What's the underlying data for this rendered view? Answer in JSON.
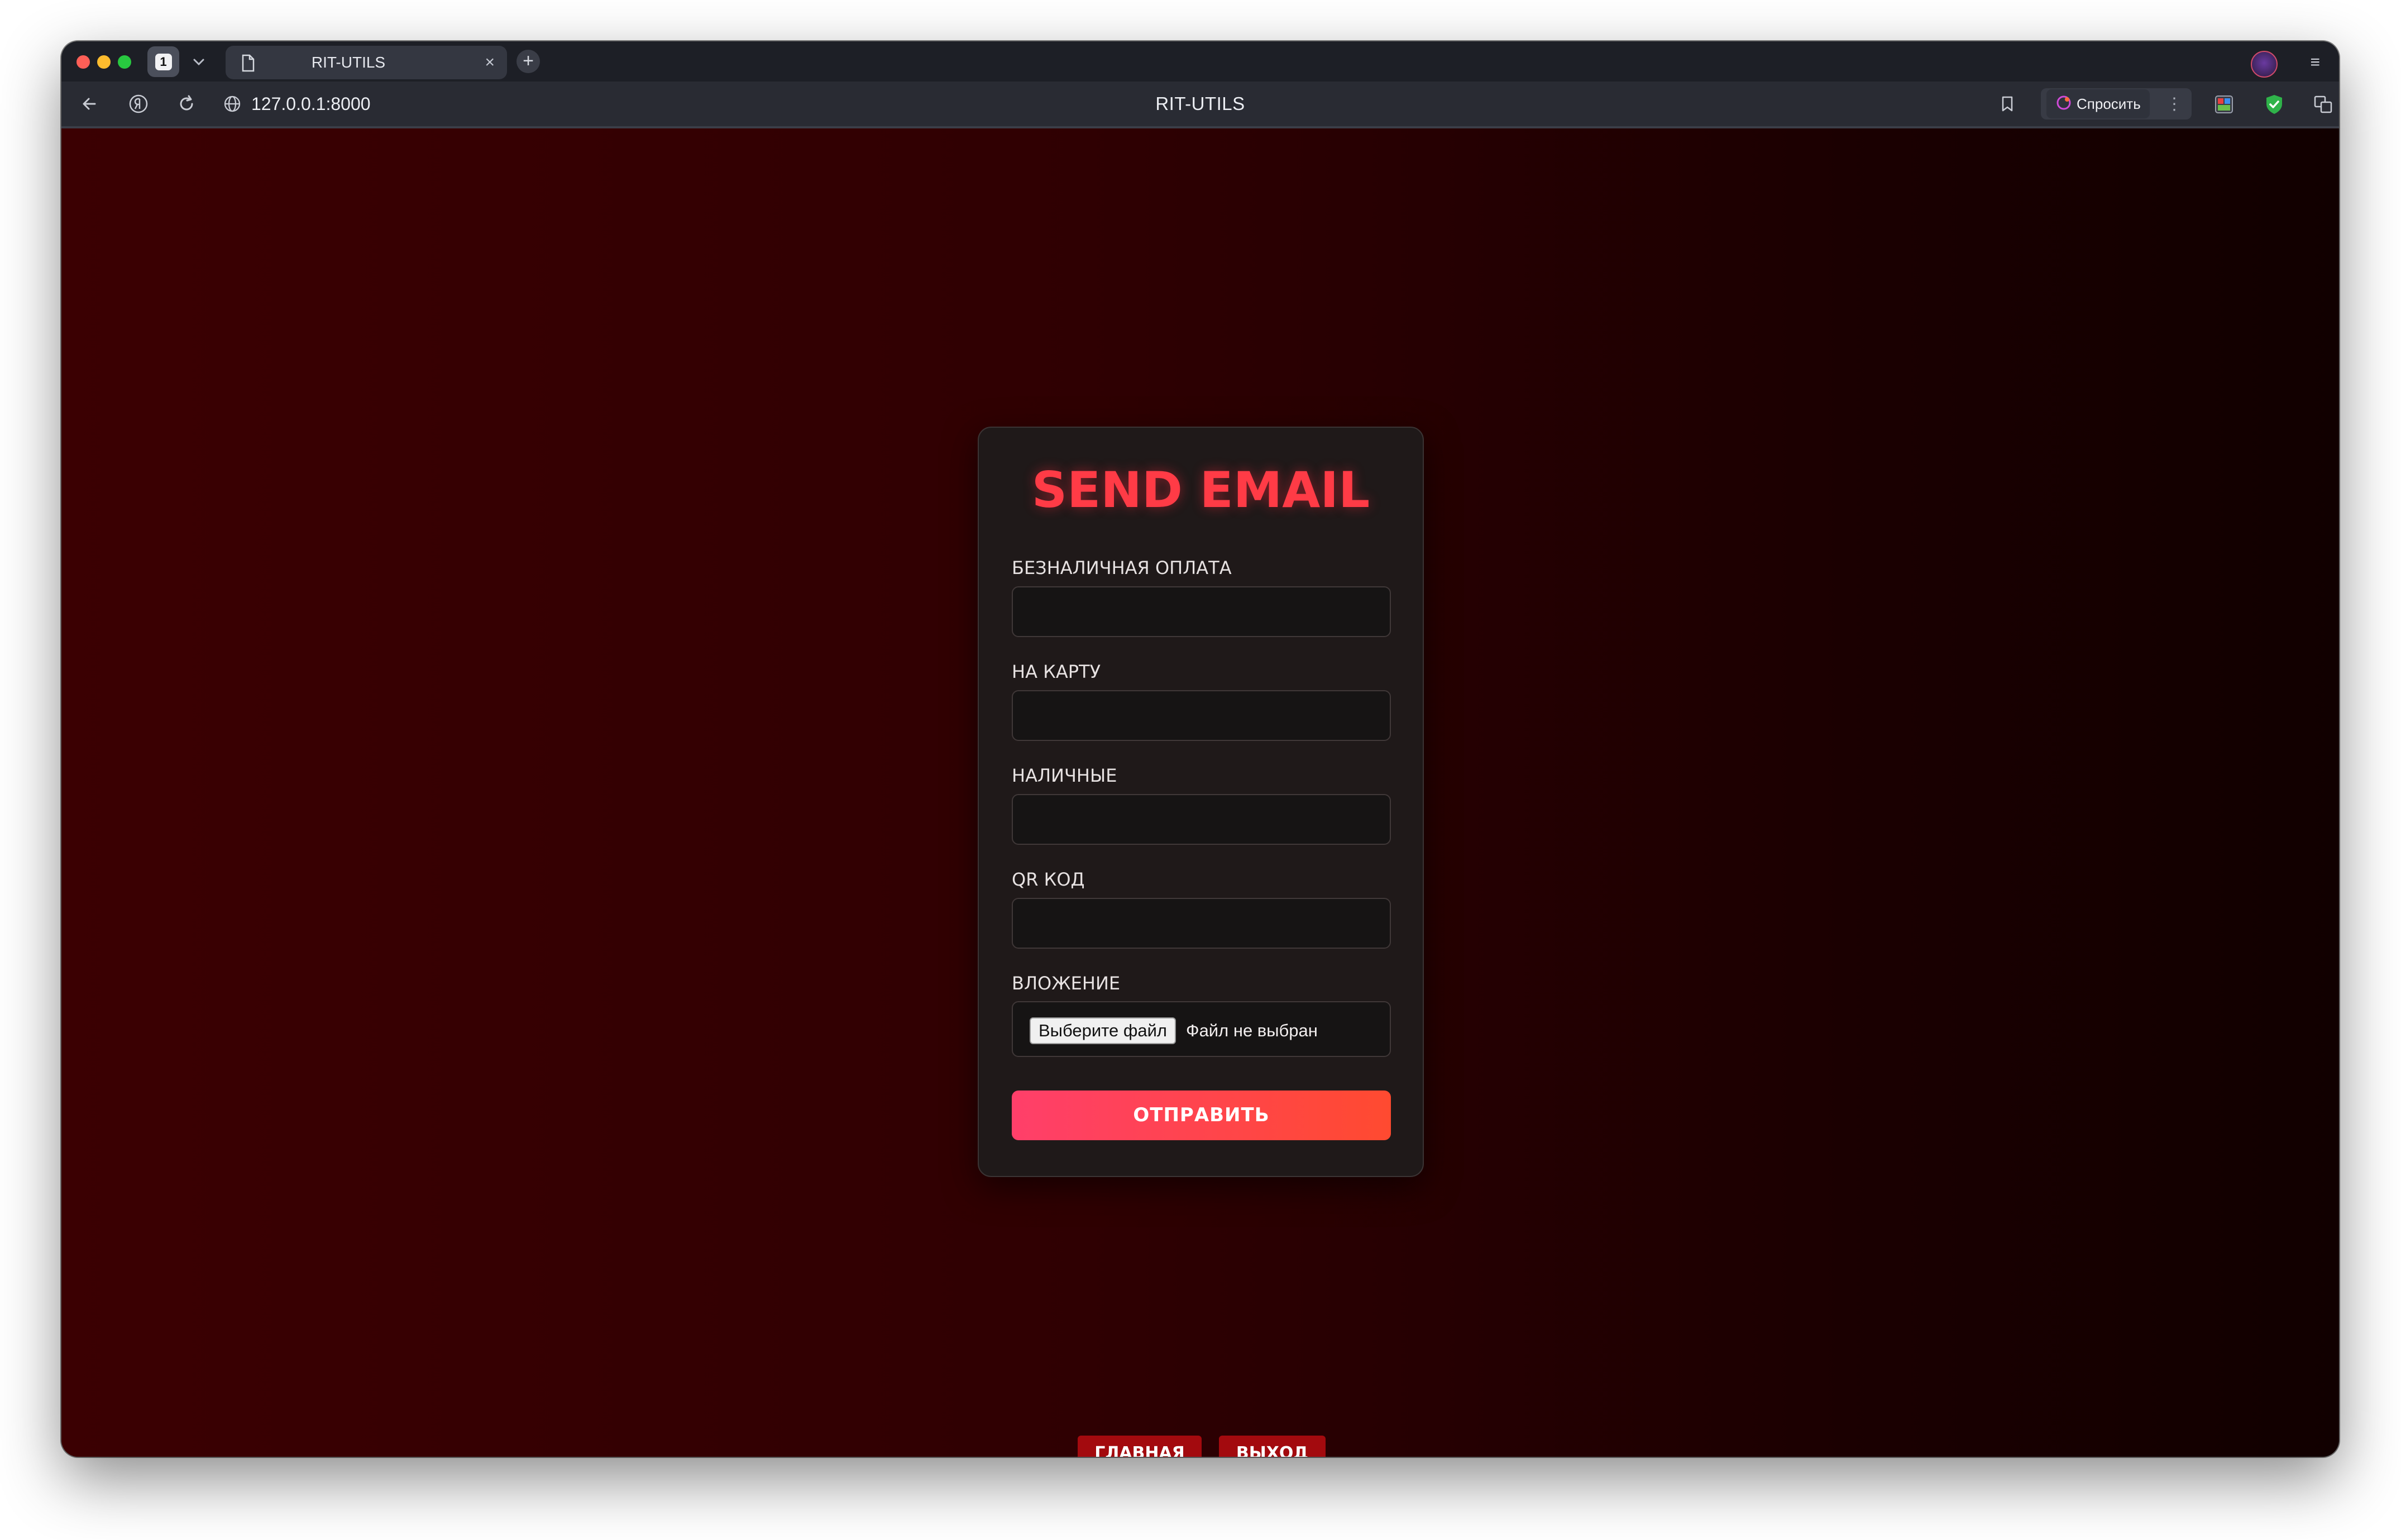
{
  "browser": {
    "tab_count": "1",
    "tab_title": "RIT-UTILS",
    "tab_close": "×",
    "new_tab": "+",
    "url": "127.0.0.1:8000",
    "page_title": "RIT-UTILS",
    "ask_button": "Спросить",
    "menu_glyph": "≡",
    "kebab_glyph": "⋮",
    "icons": [
      "back-icon",
      "yandex-icon",
      "reload-icon",
      "globe-icon",
      "bookmark-icon",
      "extension-icon",
      "shield-icon",
      "translate-icon",
      "download-icon"
    ],
    "colors": {
      "red": "#fe5f57",
      "yellow": "#febc2e",
      "green": "#28c840"
    }
  },
  "form": {
    "title": "SEND EMAIL",
    "fields": [
      {
        "label": "БЕЗНАЛИЧНАЯ ОПЛАТА",
        "value": ""
      },
      {
        "label": "НА КАРТУ",
        "value": ""
      },
      {
        "label": "НАЛИЧНЫЕ",
        "value": ""
      },
      {
        "label": "QR КОД",
        "value": ""
      }
    ],
    "attachment": {
      "label": "ВЛОЖЕНИЕ",
      "button": "Выберите файл",
      "status": "Файл не выбран"
    },
    "submit": "ОТПРАВИТЬ",
    "accent": "#ff3b46"
  },
  "footer": {
    "home": "ГЛАВНАЯ",
    "logout": "ВЫХОД"
  }
}
